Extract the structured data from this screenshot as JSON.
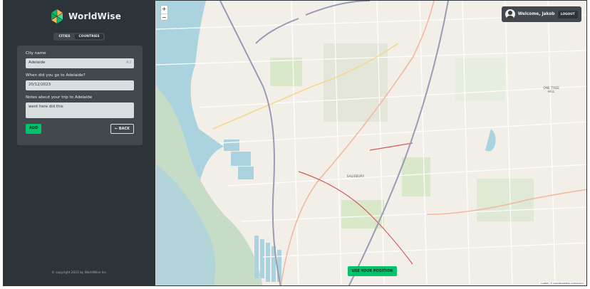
{
  "app": {
    "name": "WorldWise",
    "copyright": "© copyright 2023 by WorldWise Inc."
  },
  "nav": {
    "tabs": [
      {
        "label": "Cities"
      },
      {
        "label": "Countries"
      }
    ]
  },
  "form": {
    "city_label": "City name",
    "city_value": "Adelaide",
    "flag_text": "AU",
    "date_label": "When did you go to Adelaide?",
    "date_value": "20/12/2023",
    "notes_label": "Notes about your trip to Adelaide",
    "notes_value": "went here did this",
    "add_label": "Add",
    "back_label": "← Back"
  },
  "map": {
    "zoom_in": "+",
    "zoom_out": "−",
    "use_position_label": "Use your position",
    "labels": [
      "Salisbury",
      "One Tree Hill"
    ],
    "attribution": "Leaflet | © OpenStreetMap contributors"
  },
  "user": {
    "welcome": "Welcome, Jakob",
    "logout_label": "Logout"
  },
  "colors": {
    "brand": "#00c46a",
    "dark0": "#2d3439",
    "dark1": "#42484d",
    "light": "#d6dee0"
  }
}
